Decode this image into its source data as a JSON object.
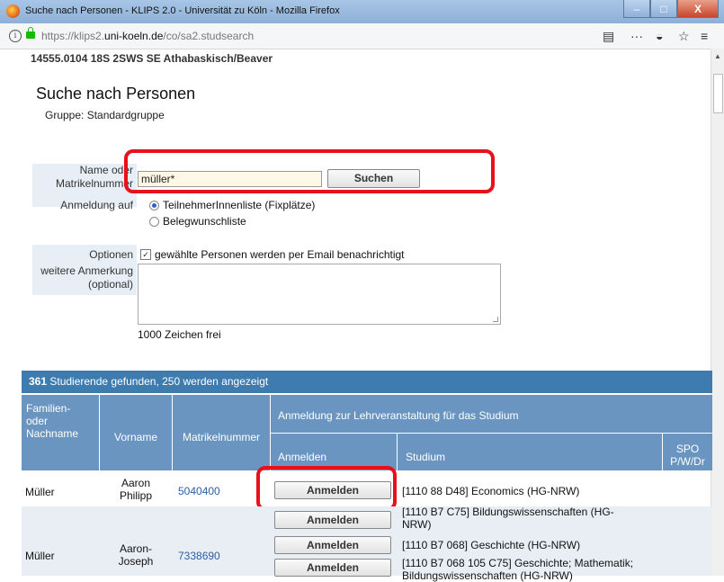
{
  "window": {
    "title": "Suche nach Personen - KLIPS 2.0 - Universität zu Köln - Mozilla Firefox",
    "minimize": "–",
    "maximize": "□",
    "close": "X"
  },
  "browser": {
    "url_prefix": "https://klips2.",
    "url_domain": "uni-koeln.de",
    "url_path": "/co/sa2.studsearch",
    "icons": [
      "info-icon",
      "lock-icon",
      "reader-view-icon",
      "more-icon",
      "pocket-icon",
      "bookmark-star-icon",
      "sidebar-icon"
    ]
  },
  "course": "14555.0104 18S 2SWS SE Athabaskisch/Beaver",
  "page": {
    "title": "Suche nach Personen",
    "group": "Gruppe: Standardgruppe"
  },
  "form": {
    "name_label_1": "Name oder",
    "name_label_2": "Matrikelnummer",
    "search_value": "müller*",
    "search_button": "Suchen",
    "registration_label": "Anmeldung auf",
    "radio_options": [
      "TeilnehmerInnenliste (Fixplätze)",
      "Belegwunschliste"
    ],
    "options_label": "Optionen",
    "notify_label": "gewählte Personen werden per Email benachrichtigt",
    "remark_label_1": "weitere Anmerkung",
    "remark_label_2": "(optional)",
    "chars_left": "1000 Zeichen frei"
  },
  "results": {
    "count": "361",
    "summary": " Studierende gefunden, 250 werden angezeigt",
    "headers": {
      "family": [
        "Familien-",
        "oder",
        "Nachname"
      ],
      "first": "Vorname",
      "matric": "Matrikelnummer",
      "registration_group": "Anmeldung zur Lehrveranstaltung für das Studium",
      "register": "Anmelden",
      "study": "Studium",
      "spo": [
        "SPO",
        "P/W/Dr"
      ]
    },
    "rows": [
      {
        "family": "Müller",
        "first": [
          "Aaron",
          "Philipp"
        ],
        "matric": "5040400",
        "studies": [
          {
            "button": "Anmelden",
            "lines": [
              "[1110 88 D48] Economics (HG-NRW)"
            ]
          }
        ]
      },
      {
        "family": "Müller",
        "first": [
          "Aaron-",
          "Joseph"
        ],
        "matric": "7338690",
        "studies": [
          {
            "button": "Anmelden",
            "lines": [
              "[1110 B7 C75] Bildungswissenschaften (HG-",
              "NRW)"
            ]
          },
          {
            "button": "Anmelden",
            "lines": [
              "[1110 B7 068] Geschichte (HG-NRW)"
            ]
          },
          {
            "button": "Anmelden",
            "lines": [
              "[1110 B7 068 105 C75] Geschichte; Mathematik;",
              "Bildungswissenschaften (HG-NRW)"
            ]
          }
        ]
      }
    ]
  }
}
